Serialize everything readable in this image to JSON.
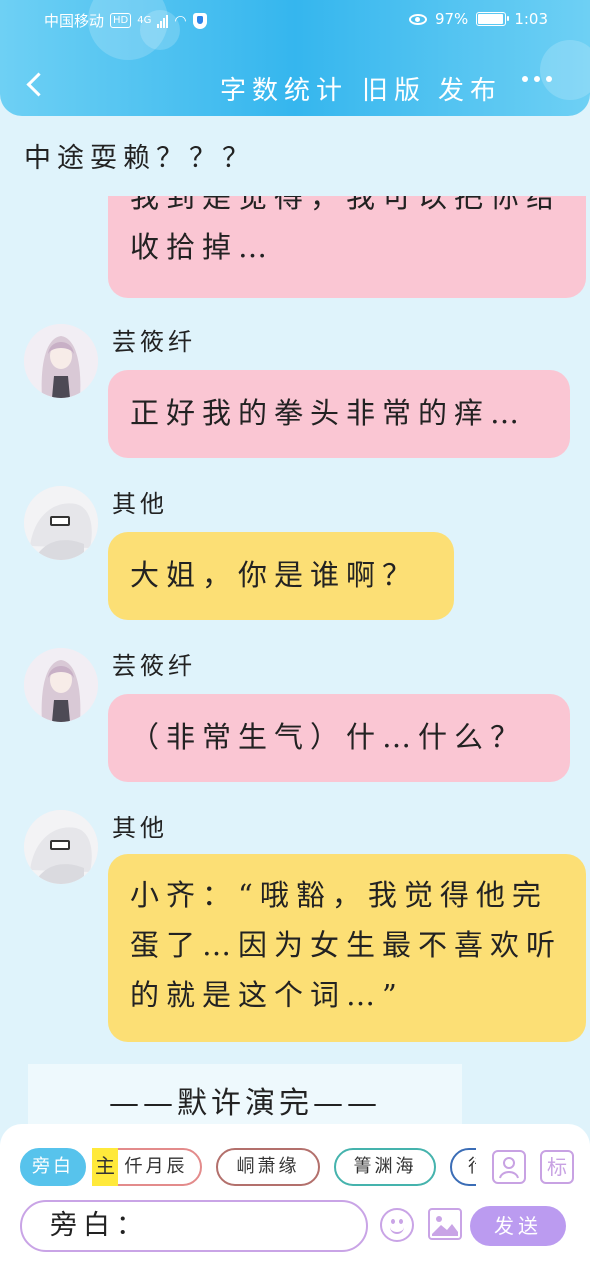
{
  "status_bar": {
    "carrier": "中国移动",
    "hd": "HD",
    "network": "4G",
    "battery_percent": "97%",
    "time": "1:03"
  },
  "nav": {
    "word_count": "字数统计",
    "old_version": "旧版",
    "publish": "发布"
  },
  "section_title": "中途耍赖？？？",
  "messages": [
    {
      "speaker": "",
      "text": "我到是觉得，我可以把你给收拾掉…",
      "color": "pink"
    },
    {
      "speaker": "芸筱纤",
      "text": "正好我的拳头非常的痒…",
      "color": "pink"
    },
    {
      "speaker": "其他",
      "text": "大姐，你是谁啊？",
      "color": "yellow"
    },
    {
      "speaker": "芸筱纤",
      "text": "（非常生气）什…什么？",
      "color": "pink"
    },
    {
      "speaker": "其他",
      "text": "小齐：“哦豁，我觉得他完蛋了…因为女生最不喜欢听的就是这个词…”",
      "color": "yellow"
    }
  ],
  "divider_text": "——默许演完——",
  "characters": {
    "narration": "旁白",
    "main_tag": "主",
    "c2": "仟月辰",
    "c3": "峒萧缘",
    "c4": "箐渊海",
    "c5": "行"
  },
  "input": {
    "prefix": "旁白："
  },
  "tools": {
    "mark_label": "标"
  },
  "send_label": "发送",
  "colors": {
    "header": "#35b6ee",
    "pink_bubble": "#fac6d3",
    "yellow_bubble": "#fcdf75",
    "accent_purple": "#bb9bf0",
    "background": "#dff3fb"
  }
}
